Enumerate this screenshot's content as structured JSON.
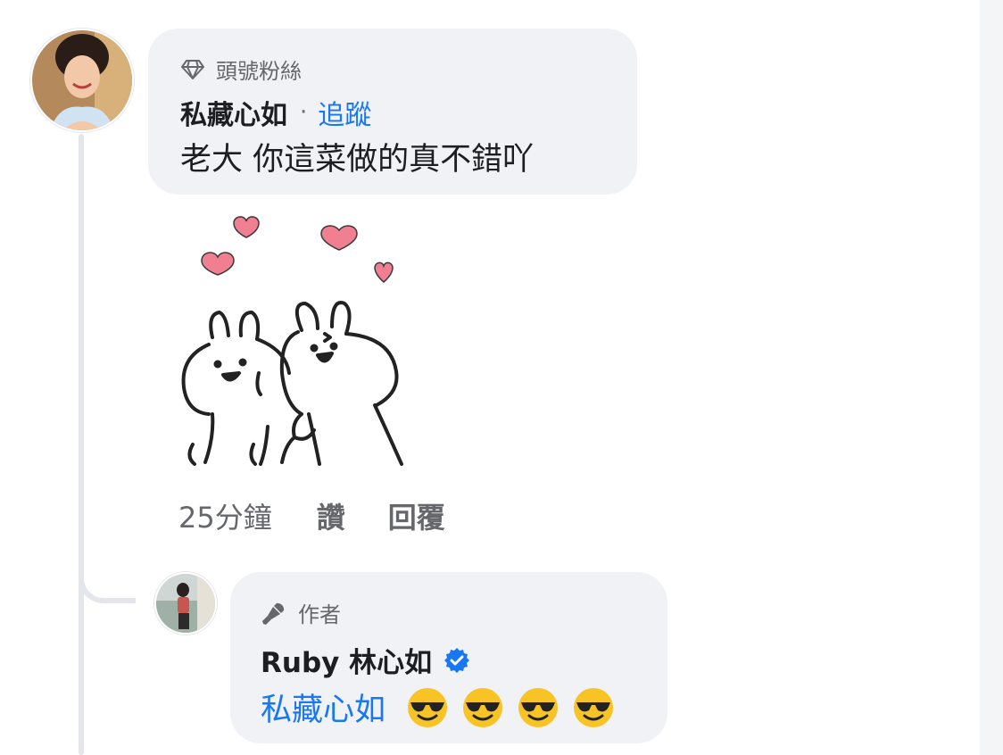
{
  "comment": {
    "badge": "頭號粉絲",
    "author": "私藏心如",
    "separator": "·",
    "follow": "追蹤",
    "text": "老大 你這菜做的真不錯吖",
    "actions": {
      "time": "25分鐘",
      "like": "讚",
      "reply": "回覆"
    }
  },
  "reply": {
    "badge": "作者",
    "author": "Ruby 林心如",
    "mention": "私藏心如",
    "emoji_icons": [
      "sunglasses-emoji",
      "sunglasses-emoji",
      "sunglasses-emoji",
      "sunglasses-emoji"
    ]
  },
  "colors": {
    "bubble": "#f0f2f5",
    "link": "#1877f2",
    "muted": "#65676b",
    "thread_line": "#e4e6eb",
    "heart": "#f07f92"
  }
}
